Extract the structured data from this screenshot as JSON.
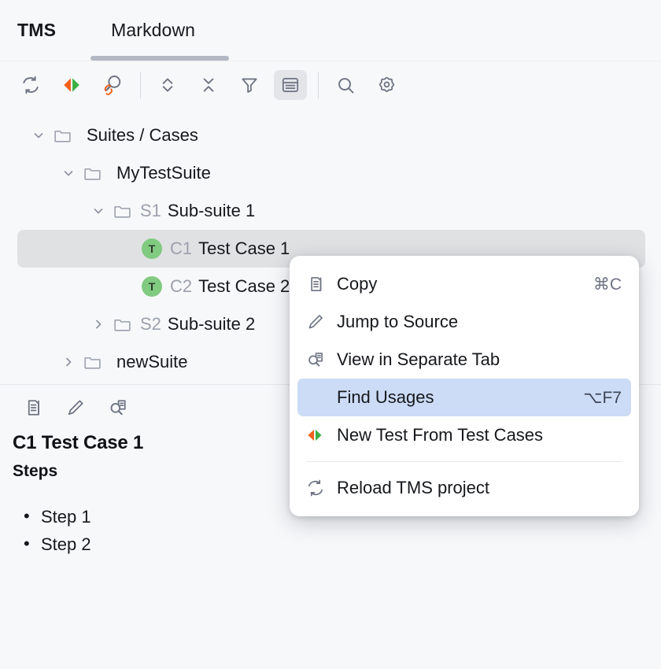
{
  "header": {
    "panel_title": "TMS",
    "tabs": [
      {
        "label": "Markdown",
        "active": true
      }
    ]
  },
  "toolbar": {
    "buttons": [
      {
        "name": "reload-icon",
        "title": "Reload"
      },
      {
        "name": "new-test-icon",
        "title": "New Test From Test Cases"
      },
      {
        "name": "find-linked-icon",
        "title": "Find Linked Tests"
      },
      {
        "name": "expand-all-icon",
        "title": "Expand All"
      },
      {
        "name": "collapse-all-icon",
        "title": "Collapse All"
      },
      {
        "name": "filter-icon",
        "title": "Filter"
      },
      {
        "name": "show-description-icon",
        "title": "Show Description",
        "active": true
      },
      {
        "name": "search-icon",
        "title": "Search"
      },
      {
        "name": "settings-gear-icon",
        "title": "Settings"
      }
    ]
  },
  "tree": {
    "rows": [
      {
        "indent": 0,
        "twisty": "down",
        "icon": "folder",
        "key": "",
        "label": "Suites / Cases",
        "selected": false
      },
      {
        "indent": 1,
        "twisty": "down",
        "icon": "folder",
        "key": "",
        "label": "MyTestSuite",
        "selected": false
      },
      {
        "indent": 2,
        "twisty": "down",
        "icon": "folder",
        "key": "S1",
        "label": "Sub-suite 1",
        "selected": false
      },
      {
        "indent": 3,
        "twisty": "none",
        "icon": "test",
        "key": "C1",
        "label": "Test Case 1",
        "selected": true
      },
      {
        "indent": 3,
        "twisty": "none",
        "icon": "test",
        "key": "C2",
        "label": "Test Case 2",
        "selected": false
      },
      {
        "indent": 2,
        "twisty": "right",
        "icon": "folder",
        "key": "S2",
        "label": "Sub-suite 2",
        "selected": false
      },
      {
        "indent": 1,
        "twisty": "right",
        "icon": "folder",
        "key": "",
        "label": "newSuite",
        "selected": false
      }
    ],
    "test_badge_letter": "T"
  },
  "detail": {
    "toolbar": [
      {
        "name": "copy-icon",
        "title": "Copy"
      },
      {
        "name": "edit-pencil-icon",
        "title": "Jump to Source"
      },
      {
        "name": "view-separate-tab-icon",
        "title": "View in Separate Tab"
      }
    ],
    "title": "C1 Test Case 1",
    "section_heading": "Steps",
    "steps": [
      "Step 1",
      "Step 2"
    ]
  },
  "context_menu": {
    "items": [
      {
        "icon": "copy-icon",
        "label": "Copy",
        "shortcut": "⌘C",
        "highlight": false,
        "separator_after": false
      },
      {
        "icon": "edit-pencil-icon",
        "label": "Jump to Source",
        "shortcut": "",
        "highlight": false,
        "separator_after": false
      },
      {
        "icon": "view-separate-tab-icon",
        "label": "View in Separate Tab",
        "shortcut": "",
        "highlight": false,
        "separator_after": false
      },
      {
        "icon": "find-usages-icon",
        "label": "Find Usages",
        "shortcut": "⌥F7",
        "highlight": true,
        "separator_after": false
      },
      {
        "icon": "new-test-icon",
        "label": "New Test From Test Cases",
        "shortcut": "",
        "highlight": false,
        "separator_after": true
      },
      {
        "icon": "reload-icon",
        "label": "Reload TMS project",
        "shortcut": "",
        "highlight": false,
        "separator_after": false
      }
    ]
  },
  "colors": {
    "background": "#f7f8fa",
    "menu_background": "#ffffff",
    "menu_highlight": "#ccdcf7",
    "row_selected": "#e0e1e3",
    "tab_underline": "#b4b8c4",
    "badge_green": "#81ca81",
    "accent_orange": "#f4601a",
    "accent_green": "#3cb043",
    "icon_gray": "#6d7382",
    "muted_text": "#9ba1ad"
  }
}
